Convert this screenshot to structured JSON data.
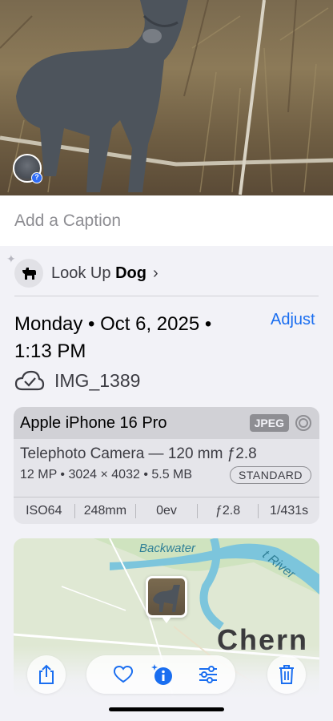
{
  "photo": {
    "subject": "dog",
    "avatar_badge": "?"
  },
  "caption": {
    "placeholder": "Add a Caption"
  },
  "lookup": {
    "prefix": "Look Up",
    "subject": "Dog",
    "chevron": "›"
  },
  "date": {
    "line": "Monday • Oct 6, 2025 •",
    "time": "1:13 PM"
  },
  "adjust_label": "Adjust",
  "file": {
    "name": "IMG_1389"
  },
  "device": {
    "name": "Apple iPhone 16 Pro",
    "format": "JPEG",
    "lens": "Telephoto Camera — 120 mm ƒ2.8",
    "specs": "12 MP • 3024 × 4032 • 5.5 MB",
    "profile": "STANDARD",
    "exif": [
      "ISO64",
      "248mm",
      "0ev",
      "ƒ2.8",
      "1/431s"
    ]
  },
  "map": {
    "labels": {
      "water": "Backwater",
      "river": "t River",
      "city": "Chern"
    }
  },
  "toolbar": {
    "icons": [
      "share-icon",
      "heart-icon",
      "info-icon",
      "adjust-icon",
      "trash-icon"
    ]
  },
  "colors": {
    "accent": "#1a6ef0",
    "background": "#f2f2f7",
    "card": "#e5e5ea"
  }
}
